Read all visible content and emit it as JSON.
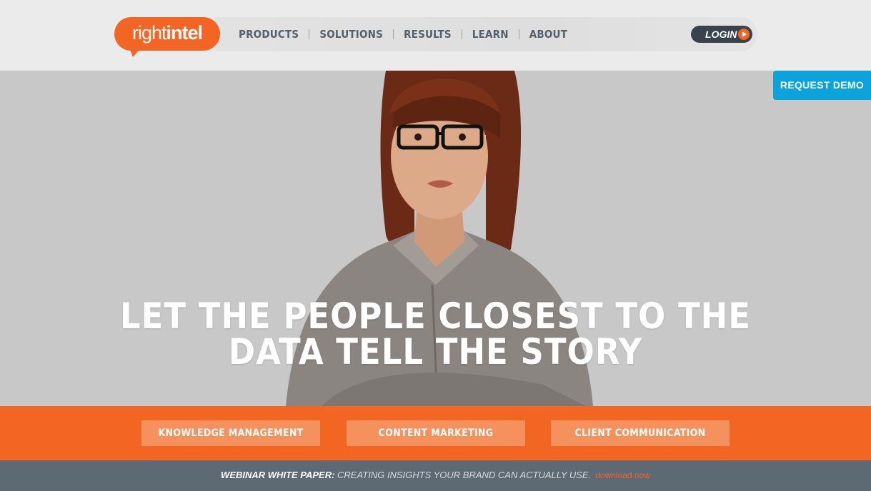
{
  "logo": {
    "part1": "right",
    "part2": "intel"
  },
  "nav": {
    "items": [
      {
        "label": "PRODUCTS"
      },
      {
        "label": "SOLUTIONS"
      },
      {
        "label": "RESULTS"
      },
      {
        "label": "LEARN"
      },
      {
        "label": "ABOUT"
      }
    ],
    "login_label": "LOGIN"
  },
  "hero": {
    "request_demo": "REQUEST DEMO",
    "headline_line1": "LET THE PEOPLE CLOSEST TO THE",
    "headline_line2": "DATA TELL THE STORY"
  },
  "band": {
    "buttons": [
      {
        "label": "KNOWLEDGE MANAGEMENT"
      },
      {
        "label": "CONTENT MARKETING"
      },
      {
        "label": "CLIENT COMMUNICATION"
      }
    ]
  },
  "footer": {
    "prefix": "WEBINAR WHITE PAPER:",
    "text": " CREATING INSIGHTS YOUR BRAND CAN ACTUALLY USE.",
    "link": "download now"
  },
  "colors": {
    "brand_orange": "#f26522",
    "nav_text": "#54606a",
    "demo_blue": "#0aa3dc",
    "footer_bg": "#5d6a73",
    "hero_bg": "#c8c8c8"
  },
  "icons": {
    "login_arrow": "play-arrow-icon"
  }
}
